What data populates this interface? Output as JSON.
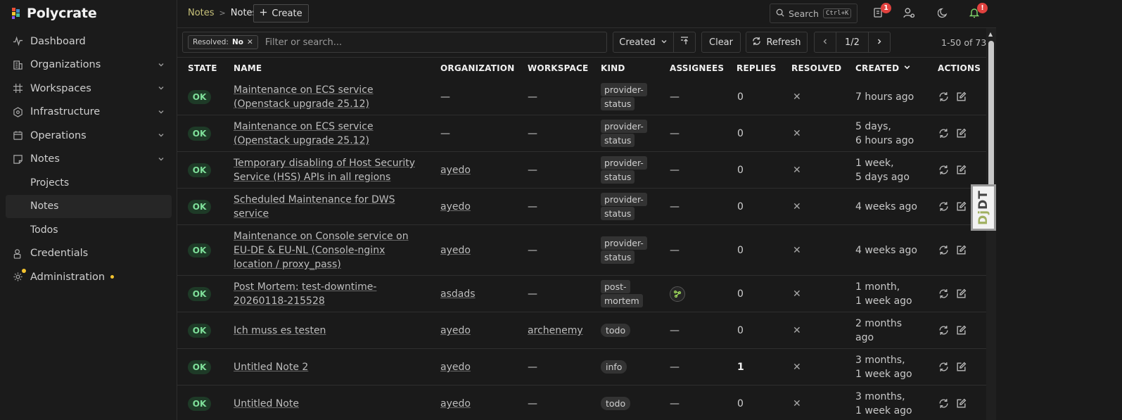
{
  "brand": {
    "name": "Polycrate"
  },
  "sidebar": {
    "items": [
      {
        "label": "Dashboard",
        "icon": "activity-icon",
        "chevron": false
      },
      {
        "label": "Organizations",
        "icon": "building-icon",
        "chevron": true
      },
      {
        "label": "Workspaces",
        "icon": "grid-hash-icon",
        "chevron": true
      },
      {
        "label": "Infrastructure",
        "icon": "hexagon-network-icon",
        "chevron": true
      },
      {
        "label": "Operations",
        "icon": "calendar-icon",
        "chevron": true
      },
      {
        "label": "Notes",
        "icon": "note-icon",
        "chevron": true,
        "expanded": true
      }
    ],
    "sub_items": [
      {
        "label": "Projects"
      },
      {
        "label": "Notes",
        "active": true
      },
      {
        "label": "Todos"
      }
    ],
    "bottom_items": [
      {
        "label": "Credentials",
        "icon": "key-lock-icon"
      },
      {
        "label": "Administration",
        "icon": "gear-user-icon",
        "dot": true
      }
    ]
  },
  "topbar": {
    "breadcrumb_root": "Notes",
    "breadcrumb_current": "Notes",
    "create_label": "Create",
    "search_label": "Search",
    "search_shortcut": "Ctrl+K",
    "notes_badge": "1",
    "alert_badge": "!"
  },
  "filters": {
    "chip_key": "Resolved:",
    "chip_value": "No",
    "placeholder": "Filter or search...",
    "sort_label": "Created",
    "clear_label": "Clear",
    "refresh_label": "Refresh",
    "page_indicator": "1/2",
    "range_text": "1-50 of 73"
  },
  "table": {
    "headers": {
      "state": "STATE",
      "name": "NAME",
      "organization": "ORGANIZATION",
      "workspace": "WORKSPACE",
      "kind": "KIND",
      "assignees": "ASSIGNEES",
      "replies": "REPLIES",
      "resolved": "RESOLVED",
      "created": "CREATED",
      "actions": "ACTIONS"
    },
    "rows": [
      {
        "state": "OK",
        "name": "Maintenance on ECS service (Openstack upgrade 25.12)",
        "org": "—",
        "workspace": "—",
        "kind1": "provider-",
        "kind2": "status",
        "assignee": "—",
        "replies": "0",
        "created1": "7 hours ago",
        "created2": ""
      },
      {
        "state": "OK",
        "name": "Maintenance on ECS service (Openstack upgrade 25.12)",
        "org": "—",
        "workspace": "—",
        "kind1": "provider-",
        "kind2": "status",
        "assignee": "—",
        "replies": "0",
        "created1": "5 days,",
        "created2": "6 hours ago"
      },
      {
        "state": "OK",
        "name": "Temporary disabling of Host Security Service (HSS) APIs in all regions",
        "org": "ayedo",
        "workspace": "—",
        "kind1": "provider-",
        "kind2": "status",
        "assignee": "—",
        "replies": "0",
        "created1": "1 week,",
        "created2": "5 days ago"
      },
      {
        "state": "OK",
        "name": "Scheduled Maintenance for DWS service",
        "org": "ayedo",
        "workspace": "—",
        "kind1": "provider-",
        "kind2": "status",
        "assignee": "—",
        "replies": "0",
        "created1": "4 weeks ago",
        "created2": ""
      },
      {
        "state": "OK",
        "name": "Maintenance on Console service on EU-DE & EU-NL (Console-nginx location / proxy_pass)",
        "org": "ayedo",
        "workspace": "—",
        "kind1": "provider-",
        "kind2": "status",
        "assignee": "—",
        "replies": "0",
        "created1": "4 weeks ago",
        "created2": ""
      },
      {
        "state": "OK",
        "name": "Post Mortem: test-downtime-20260118-215528",
        "org": "asdads",
        "workspace": "—",
        "kind1": "post-",
        "kind2": "mortem",
        "assignee": "avatar",
        "replies": "0",
        "created1": "1 month,",
        "created2": "1 week ago"
      },
      {
        "state": "OK",
        "name": "Ich muss es testen",
        "org": "ayedo",
        "workspace": "archenemy",
        "kind1": "todo",
        "kind2": "",
        "assignee": "—",
        "replies": "0",
        "created1": "2 months",
        "created2": "ago"
      },
      {
        "state": "OK",
        "name": "Untitled Note 2",
        "org": "ayedo",
        "workspace": "—",
        "kind1": "info",
        "kind2": "",
        "assignee": "—",
        "replies": "1",
        "created1": "3 months,",
        "created2": "1 week ago"
      },
      {
        "state": "OK",
        "name": "Untitled Note",
        "org": "ayedo",
        "workspace": "—",
        "kind1": "todo",
        "kind2": "",
        "assignee": "—",
        "replies": "0",
        "created1": "3 months,",
        "created2": "1 week ago"
      }
    ]
  },
  "debug_toolbar": {
    "label_dj": "Dj",
    "label_dt": "DT"
  },
  "colors": {
    "accent_ok_bg": "#1e3a27",
    "accent_ok_fg": "#7fe09a",
    "badge_red": "#e0413e",
    "crumb_link": "#c8c27a"
  }
}
